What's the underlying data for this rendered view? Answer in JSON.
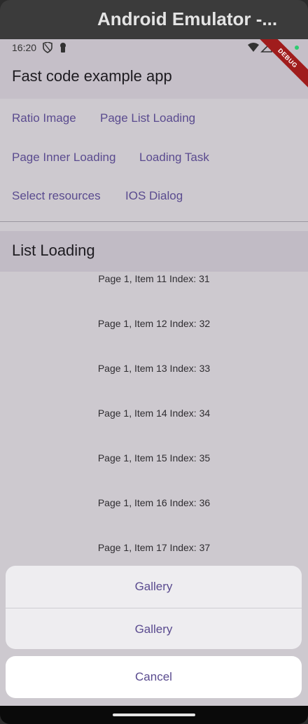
{
  "window": {
    "title": "Android Emulator -..."
  },
  "status_bar": {
    "time": "16:20",
    "left_icons": [
      "shield-icon",
      "keyhole-icon"
    ],
    "right_icons": [
      "wifi-icon",
      "signal-icon",
      "battery-icon"
    ],
    "notification_dot_color": "#2ecc71"
  },
  "debug_banner": {
    "label": "DEBUG",
    "color": "#a01c1c"
  },
  "app_bar": {
    "title": "Fast code example app"
  },
  "nav": {
    "links": [
      "Ratio Image",
      "Page List Loading",
      "Page Inner Loading",
      "Loading Task",
      "Select resources",
      "IOS Dialog"
    ]
  },
  "section": {
    "title": "List Loading"
  },
  "list": {
    "items": [
      "Page 1, Item 11  Index: 31",
      "Page 1, Item 12  Index: 32",
      "Page 1, Item 13  Index: 33",
      "Page 1, Item 14  Index: 34",
      "Page 1, Item 15  Index: 35",
      "Page 1, Item 16  Index: 36",
      "Page 1, Item 17  Index: 37"
    ]
  },
  "action_sheet": {
    "actions": [
      "Gallery",
      "Gallery"
    ],
    "cancel": "Cancel"
  },
  "colors": {
    "accent": "#5a4b8f",
    "surface": "#cdc9cf",
    "app_bar": "#c5bfc8"
  }
}
